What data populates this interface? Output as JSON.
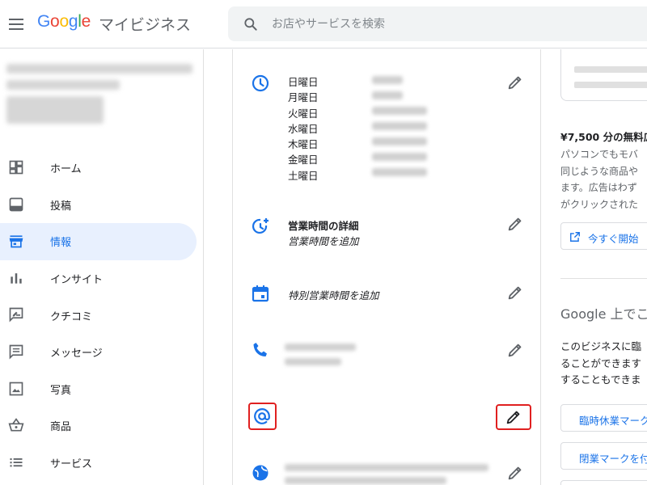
{
  "header": {
    "logo_letters": [
      "G",
      "o",
      "o",
      "g",
      "l",
      "e"
    ],
    "product": "マイビジネス",
    "search_placeholder": "お店やサービスを検索"
  },
  "sidebar": {
    "items": [
      {
        "label": "ホーム",
        "icon": "dashboard-icon",
        "active": false
      },
      {
        "label": "投稿",
        "icon": "posts-icon",
        "active": false
      },
      {
        "label": "情報",
        "icon": "storefront-icon",
        "active": true
      },
      {
        "label": "インサイト",
        "icon": "bar-chart-icon",
        "active": false
      },
      {
        "label": "クチコミ",
        "icon": "rate-review-icon",
        "active": false
      },
      {
        "label": "メッセージ",
        "icon": "message-icon",
        "active": false
      },
      {
        "label": "写真",
        "icon": "photo-icon",
        "active": false
      },
      {
        "label": "商品",
        "icon": "basket-icon",
        "active": false
      },
      {
        "label": "サービス",
        "icon": "list-icon",
        "active": false
      }
    ]
  },
  "info": {
    "days": [
      "日曜日",
      "月曜日",
      "火曜日",
      "水曜日",
      "木曜日",
      "金曜日",
      "土曜日"
    ],
    "hours_detail_title": "営業時間の詳細",
    "hours_detail_sub": "営業時間を追加",
    "special_hours": "特別営業時間を追加"
  },
  "right_panel": {
    "promo_title": "¥7,500 分の無料広",
    "promo_lines": [
      "パソコンでもモバ",
      "同じような商品や",
      "ます。広告はわず",
      "がクリックされた"
    ],
    "start_button": "今すぐ開始",
    "section_title": "Google 上でこ",
    "section_lines": [
      "このビジネスに臨",
      "ることができます",
      "することもできま"
    ],
    "temp_closed_button": "臨時休業マーク",
    "closed_button": "閉業マークを付"
  },
  "colors": {
    "accent": "#1a73e8",
    "active_bg": "#e8f0fe",
    "highlight": "#e02020"
  }
}
